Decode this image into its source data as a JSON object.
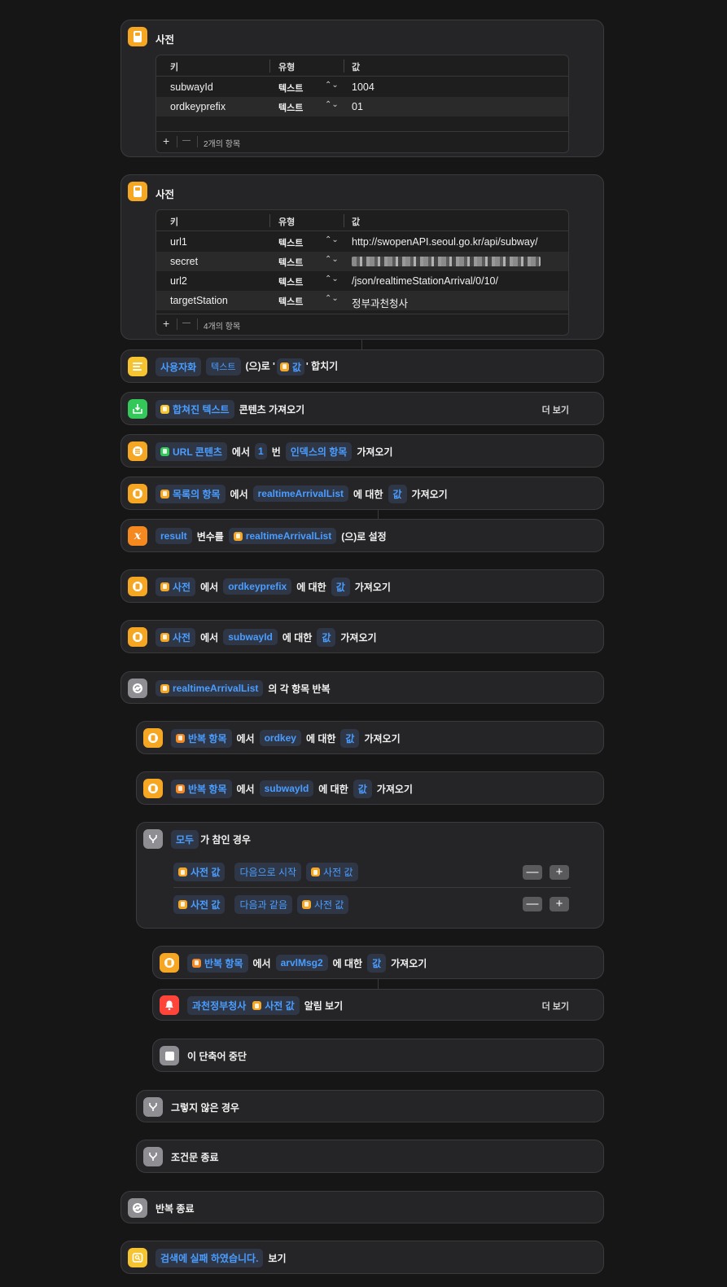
{
  "dict1": {
    "title": "사전",
    "headers": {
      "key": "키",
      "type": "유형",
      "value": "값"
    },
    "rows": [
      {
        "key": "subwayId",
        "type": "텍스트",
        "value": "1004"
      },
      {
        "key": "ordkeyprefix",
        "type": "텍스트",
        "value": "01"
      }
    ],
    "add": "+",
    "remove": "—",
    "count": "2개의 항목"
  },
  "dict2": {
    "title": "사전",
    "headers": {
      "key": "키",
      "type": "유형",
      "value": "값"
    },
    "rows": [
      {
        "key": "url1",
        "type": "텍스트",
        "value": "http://swopenAPI.seoul.go.kr/api/subway/"
      },
      {
        "key": "secret",
        "type": "텍스트",
        "value": ""
      },
      {
        "key": "url2",
        "type": "텍스트",
        "value": "/json/realtimeStationArrival/0/10/"
      },
      {
        "key": "targetStation",
        "type": "텍스트",
        "value": "정부과천청사"
      }
    ],
    "add": "+",
    "remove": "—",
    "count": "4개의 항목"
  },
  "a1": {
    "t1": "사용자화",
    "t2": "텍스트",
    "t3": "(으)로 '",
    "t4": "값",
    "t5": "' 합치기"
  },
  "a2": {
    "t1": "합쳐진 텍스트",
    "t2": "콘텐츠 가져오기",
    "more": "더 보기"
  },
  "a3": {
    "t1": "URL 콘텐츠",
    "t2": "에서",
    "t3": "1",
    "t4": "번",
    "t5": "인덱스의 항목",
    "t6": "가져오기"
  },
  "a4": {
    "t1": "목록의 항목",
    "t2": "에서",
    "t3": "realtimeArrivalList",
    "t4": "에 대한",
    "t5": "값",
    "t6": "가져오기"
  },
  "a5": {
    "t1": "result",
    "t2": "변수를",
    "t3": "realtimeArrivalList",
    "t4": "(으)로 설정"
  },
  "a6": {
    "t1": "사전",
    "t2": "에서",
    "t3": "ordkeyprefix",
    "t4": "에 대한",
    "t5": "값",
    "t6": "가져오기"
  },
  "a7": {
    "t1": "사전",
    "t2": "에서",
    "t3": "subwayId",
    "t4": "에 대한",
    "t5": "값",
    "t6": "가져오기"
  },
  "a8": {
    "t1": "realtimeArrivalList",
    "t2": "의 각 항목 반복"
  },
  "a9": {
    "t1": "반복 항목",
    "t2": "에서",
    "t3": "ordkey",
    "t4": "에 대한",
    "t5": "값",
    "t6": "가져오기"
  },
  "a10": {
    "t1": "반복 항목",
    "t2": "에서",
    "t3": "subwayId",
    "t4": "에 대한",
    "t5": "값",
    "t6": "가져오기"
  },
  "a11": {
    "t1": "모두",
    "t2": "가 참인 경우",
    "c1": {
      "a": "사전 값",
      "op": "다음으로 시작",
      "b": "사전 값"
    },
    "c2": {
      "a": "사전 값",
      "op": "다음과 같음",
      "b": "사전 값"
    },
    "minus": "—",
    "plus": "+"
  },
  "a12": {
    "t1": "반복 항목",
    "t2": "에서",
    "t3": "arvlMsg2",
    "t4": "에 대한",
    "t5": "값",
    "t6": "가져오기"
  },
  "a13": {
    "t1": "과천정부청사",
    "t2": "사전 값",
    "t3": "알림 보기",
    "more": "더 보기"
  },
  "a14": {
    "t1": "이 단축어 중단"
  },
  "a15": {
    "t1": "그렇지 않은 경우"
  },
  "a16": {
    "t1": "조건문 종료"
  },
  "a17": {
    "t1": "반복 종료"
  },
  "a18": {
    "t1": "검색에 실패 하였습니다.",
    "t2": "보기"
  },
  "colors": {
    "orange": "#f5a623",
    "yellow": "#f6c431",
    "green": "#34c759",
    "gray": "#8e8e93",
    "red": "#ff453a",
    "accent": "#4a9dff"
  }
}
